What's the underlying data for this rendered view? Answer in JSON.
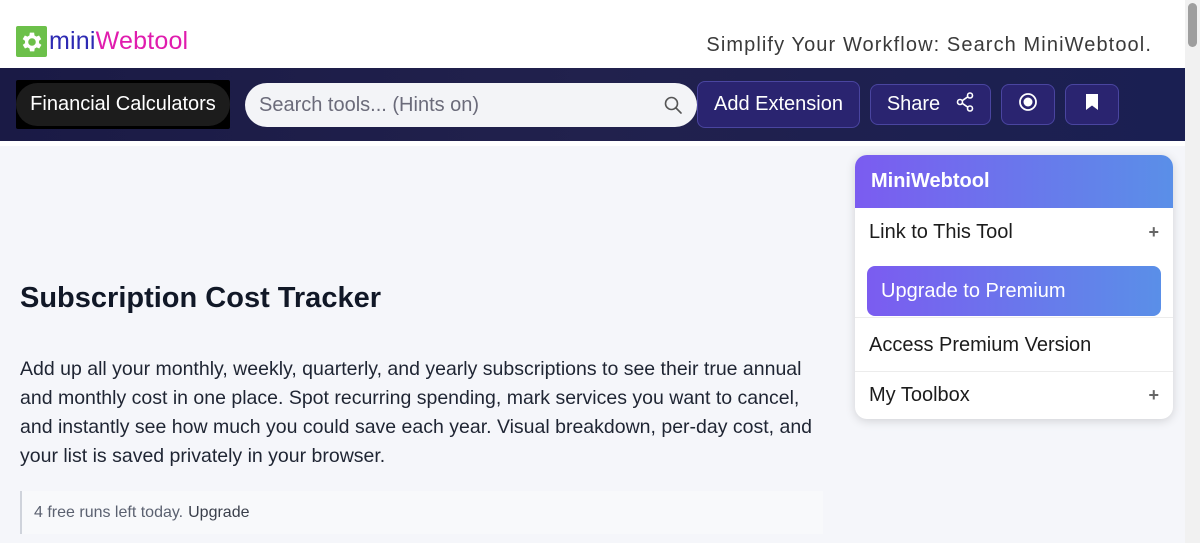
{
  "header": {
    "logo": {
      "mini": "mini",
      "webtool": "Webtool"
    },
    "tagline": "Simplify Your Workflow: Search MiniWebtool."
  },
  "nav": {
    "category_label": "Financial Calculators",
    "search_placeholder": "Search tools... (Hints on)",
    "add_extension_label": "Add Extension",
    "share_label": "Share"
  },
  "main": {
    "title": "Subscription Cost Tracker",
    "description": "Add up all your monthly, weekly, quarterly, and yearly subscriptions to see their true annual and monthly cost in one place. Spot recurring spending, mark services you want to cancel, and instantly see how much you could save each year. Visual breakdown, per-day cost, and your list is saved privately in your browser.",
    "notice_text": "4 free runs left today.",
    "notice_link": "Upgrade"
  },
  "side_card": {
    "title": "MiniWebtool",
    "link_label": "Link to This Tool",
    "premium_label": "Upgrade to Premium",
    "access_label": "Access Premium Version",
    "toolbox_label": "My Toolbox",
    "plus_symbol": "+"
  },
  "colors": {
    "navbar": "#1d1d4a",
    "accent_gradient_start": "#7b5cf0",
    "accent_gradient_end": "#5a8fe8",
    "logo_green": "#6cc04a"
  }
}
